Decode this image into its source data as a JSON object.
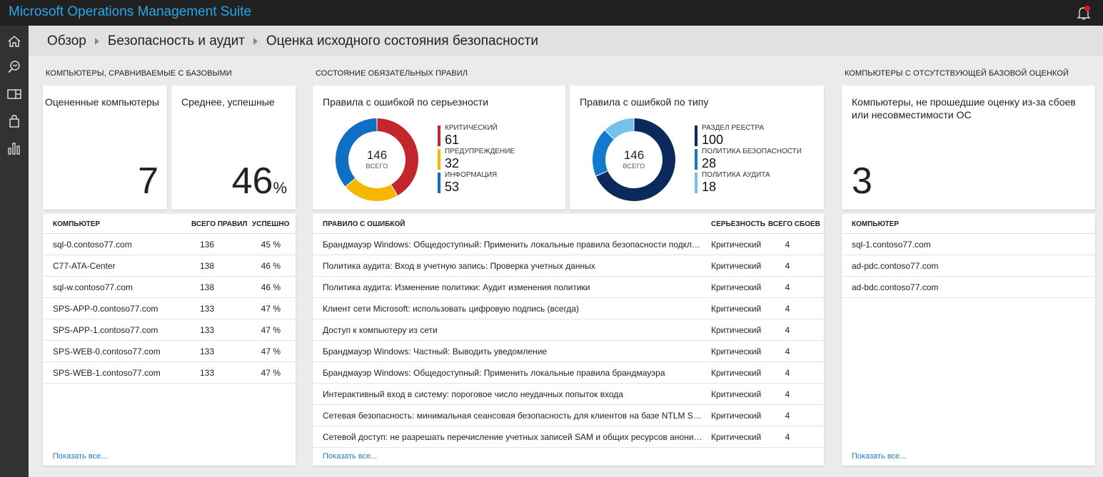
{
  "app": {
    "title": "Microsoft Operations Management Suite"
  },
  "nav": {
    "icons": [
      "home-icon",
      "search-icon",
      "dashboard-icon",
      "solutions-icon",
      "chart-icon"
    ]
  },
  "breadcrumb": [
    "Обзор",
    "Безопасность и аудит",
    "Оценка исходного состояния безопасности"
  ],
  "computers": {
    "section_title": "КОМПЬЮТЕРЫ, СРАВНИВАЕМЫЕ С БАЗОВЫМИ",
    "assessed_label": "Оцененные компьютеры",
    "assessed_value": "7",
    "avg_label": "Среднее, успешные",
    "avg_value": "46",
    "avg_unit": "%",
    "columns": [
      "КОМПЬЮТЕР",
      "ВСЕГО ПРАВИЛ",
      "УСПЕШНО"
    ],
    "rows": [
      {
        "name": "sql-0.contoso77.com",
        "total": "136",
        "passed": "45 %"
      },
      {
        "name": "C77-ATA-Center",
        "total": "138",
        "passed": "46 %"
      },
      {
        "name": "sql-w.contoso77.com",
        "total": "138",
        "passed": "46 %"
      },
      {
        "name": "SPS-APP-0.contoso77.com",
        "total": "133",
        "passed": "47 %"
      },
      {
        "name": "SPS-APP-1.contoso77.com",
        "total": "133",
        "passed": "47 %"
      },
      {
        "name": "SPS-WEB-0.contoso77.com",
        "total": "133",
        "passed": "47 %"
      },
      {
        "name": "SPS-WEB-1.contoso77.com",
        "total": "133",
        "passed": "47 %"
      }
    ],
    "show_all": "Показать все..."
  },
  "rules": {
    "section_title": "СОСТОЯНИЕ ОБЯЗАТЕЛЬНЫХ ПРАВИЛ",
    "by_severity": {
      "title": "Правила с ошибкой по серьезности",
      "total": "146",
      "total_label": "ВСЕГО",
      "items": [
        {
          "label": "КРИТИЧЕСКИЙ",
          "value": "61",
          "color": "#c1272d"
        },
        {
          "label": "ПРЕДУПРЕЖДЕНИЕ",
          "value": "32",
          "color": "#f5b700"
        },
        {
          "label": "ИНФОРМАЦИЯ",
          "value": "53",
          "color": "#0f6fc6"
        }
      ]
    },
    "by_type": {
      "title": "Правила с ошибкой по типу",
      "total": "146",
      "total_label": "ВСЕГО",
      "items": [
        {
          "label": "РАЗДЕЛ РЕЕСТРА",
          "value": "100",
          "color": "#0b2a5b"
        },
        {
          "label": "ПОЛИТИКА БЕЗОПАСНОСТИ",
          "value": "28",
          "color": "#1279cf"
        },
        {
          "label": "ПОЛИТИКА АУДИТА",
          "value": "18",
          "color": "#74c2ea"
        }
      ]
    },
    "columns": [
      "ПРАВИЛО С ОШИБКОЙ",
      "СЕРЬЕЗНОСТЬ",
      "ВСЕГО СБОЕВ"
    ],
    "rows": [
      {
        "rule": "Брандмауэр Windows: Общедоступный: Применить локальные правила безопасности подклю...",
        "severity": "Критический",
        "failures": "4"
      },
      {
        "rule": "Политика аудита: Вход в учетную запись: Проверка учетных данных",
        "severity": "Критический",
        "failures": "4"
      },
      {
        "rule": "Политика аудита: Изменение политики: Аудит изменения политики",
        "severity": "Критический",
        "failures": "4"
      },
      {
        "rule": "Клиент сети Microsoft: использовать цифровую подпись (всегда)",
        "severity": "Критический",
        "failures": "4"
      },
      {
        "rule": "Доступ к компьютеру из сети",
        "severity": "Критический",
        "failures": "4"
      },
      {
        "rule": "Брандмауэр Windows: Частный: Выводить уведомление",
        "severity": "Критический",
        "failures": "4"
      },
      {
        "rule": "Брандмауэр Windows: Общедоступный: Применить локальные правила брандмауэра",
        "severity": "Критический",
        "failures": "4"
      },
      {
        "rule": "Интерактивный вход в систему: пороговое число неудачных попыток входа",
        "severity": "Критический",
        "failures": "4"
      },
      {
        "rule": "Сетевая безопасность: минимальная сеансовая безопасность для клиентов на базе NTLM SSP...",
        "severity": "Критический",
        "failures": "4"
      },
      {
        "rule": "Сетевой доступ: не разрешать перечисление учетных записей SAM и общих ресурсов аноним...",
        "severity": "Критический",
        "failures": "4"
      }
    ],
    "show_all": "Показать все..."
  },
  "missing": {
    "section_title": "КОМПЬЮТЕРЫ С ОТСУТСТВУЮЩЕЙ БАЗОВОЙ ОЦЕНКОЙ",
    "label": "Компьютеры, не прошедшие оценку из-за сбоев или несовместимости ОС",
    "value": "3",
    "columns": [
      "КОМПЬЮТЕР"
    ],
    "rows": [
      {
        "name": "sql-1.contoso77.com"
      },
      {
        "name": "ad-pdc.contoso77.com"
      },
      {
        "name": "ad-bdc.contoso77.com"
      }
    ],
    "show_all": "Показать все..."
  },
  "colors": {
    "accent": "#2aa6e8",
    "link": "#1f7ac8",
    "alert": "#e81123"
  }
}
